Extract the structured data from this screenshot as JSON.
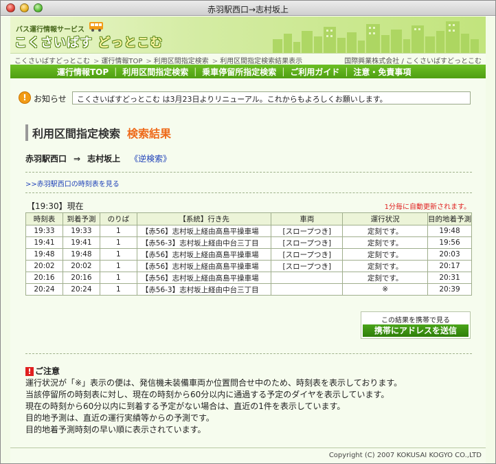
{
  "window": {
    "title": "赤羽駅西口→志村坂上"
  },
  "header": {
    "logo_sub": "バス運行情報サービス",
    "logo_main_a": "こくさいばす",
    "logo_main_b": "どっとこむ"
  },
  "breadcrumb": {
    "items": [
      "こくさいばすどっとこむ",
      "運行情報TOP",
      "利用区間指定検索",
      "利用区間指定検索結果表示"
    ],
    "owner": "国際興業株式会社 / こくさいばすどっとこむ"
  },
  "nav": {
    "items": [
      "運行情報TOP",
      "利用区間指定検索",
      "乗車停留所指定検索",
      "ご利用ガイド",
      "注意・免責事項"
    ]
  },
  "notice": {
    "label": "お知らせ",
    "text": "こくさいばすどっとこむ は3月23日よりリニューアル。これからもよろしくお願いします。"
  },
  "page": {
    "title": "利用区間指定検索",
    "title_accent": "検索結果",
    "from": "赤羽駅西口",
    "arrow": "⇒",
    "to": "志村坂上",
    "reverse": "《逆検索》",
    "timetable_link": ">>赤羽駅西口の時刻表を見る",
    "current_time": "【19:30】現在",
    "auto_update": "1分毎に自動更新されます。"
  },
  "table": {
    "headers": [
      "時刻表",
      "到着予測",
      "のりば",
      "【系統】行き先",
      "車両",
      "運行状況",
      "目的地着予測"
    ],
    "rows": [
      [
        "19:33",
        "19:33",
        "1",
        "【赤56】志村坂上経由高島平操車場",
        "[スロープつき]",
        "定刻です。",
        "19:48"
      ],
      [
        "19:41",
        "19:41",
        "1",
        "【赤56-3】志村坂上経由中台三丁目",
        "[スロープつき]",
        "定刻です。",
        "19:56"
      ],
      [
        "19:48",
        "19:48",
        "1",
        "【赤56】志村坂上経由高島平操車場",
        "[スロープつき]",
        "定刻です。",
        "20:03"
      ],
      [
        "20:02",
        "20:02",
        "1",
        "【赤56】志村坂上経由高島平操車場",
        "[スロープつき]",
        "定刻です。",
        "20:17"
      ],
      [
        "20:16",
        "20:16",
        "1",
        "【赤56】志村坂上経由高島平操車場",
        "",
        "定刻です。",
        "20:31"
      ],
      [
        "20:24",
        "20:24",
        "1",
        "【赤56-3】志村坂上経由中台三丁目",
        "",
        "※",
        "20:39"
      ]
    ]
  },
  "mobile": {
    "label": "この結果を携帯で見る",
    "button": "携帯にアドレスを送信"
  },
  "caution": {
    "title": "ご注意",
    "lines": [
      "運行状況が「※」表示の便は、発信機未装備車両か位置問合せ中のため、時刻表を表示しております。",
      "当該停留所の時刻表に対し、現在の時刻から60分以内に通過する予定のダイヤを表示しています。",
      "現在の時刻から60分以内に到着する予定がない場合は、直近の1件を表示しています。",
      "目的地予測は、直近の運行実績等からの予測です。",
      "目的地着予測時刻の早い順に表示されています。"
    ]
  },
  "footer": {
    "copyright": "Copyright (C) 2007 KOKUSAI KOGYO CO.,LTD"
  }
}
